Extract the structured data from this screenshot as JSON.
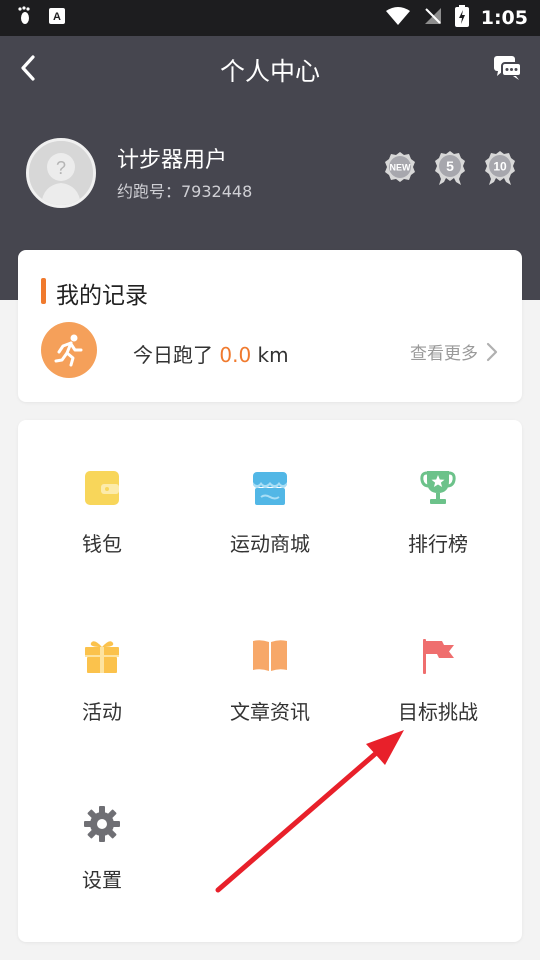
{
  "status_bar": {
    "time": "1:05"
  },
  "header": {
    "title": "个人中心",
    "user_name": "计步器用户",
    "user_id": "约跑号：7932448",
    "badges": [
      "NEW",
      "5",
      "10"
    ]
  },
  "record": {
    "title": "我的记录",
    "today_prefix": "今日跑了 ",
    "today_value": "0.0",
    "today_unit": " km",
    "more": "查看更多"
  },
  "menu": {
    "items": [
      {
        "label": "钱包",
        "icon": "wallet-icon"
      },
      {
        "label": "运动商城",
        "icon": "store-icon"
      },
      {
        "label": "排行榜",
        "icon": "trophy-icon"
      },
      {
        "label": "活动",
        "icon": "gift-icon"
      },
      {
        "label": "文章资讯",
        "icon": "book-icon"
      },
      {
        "label": "目标挑战",
        "icon": "flag-icon"
      },
      {
        "label": "设置",
        "icon": "gear-icon"
      }
    ]
  },
  "colors": {
    "header": "#46464f",
    "accent": "#f07a2e",
    "annotation_arrow": "#e8202a"
  }
}
